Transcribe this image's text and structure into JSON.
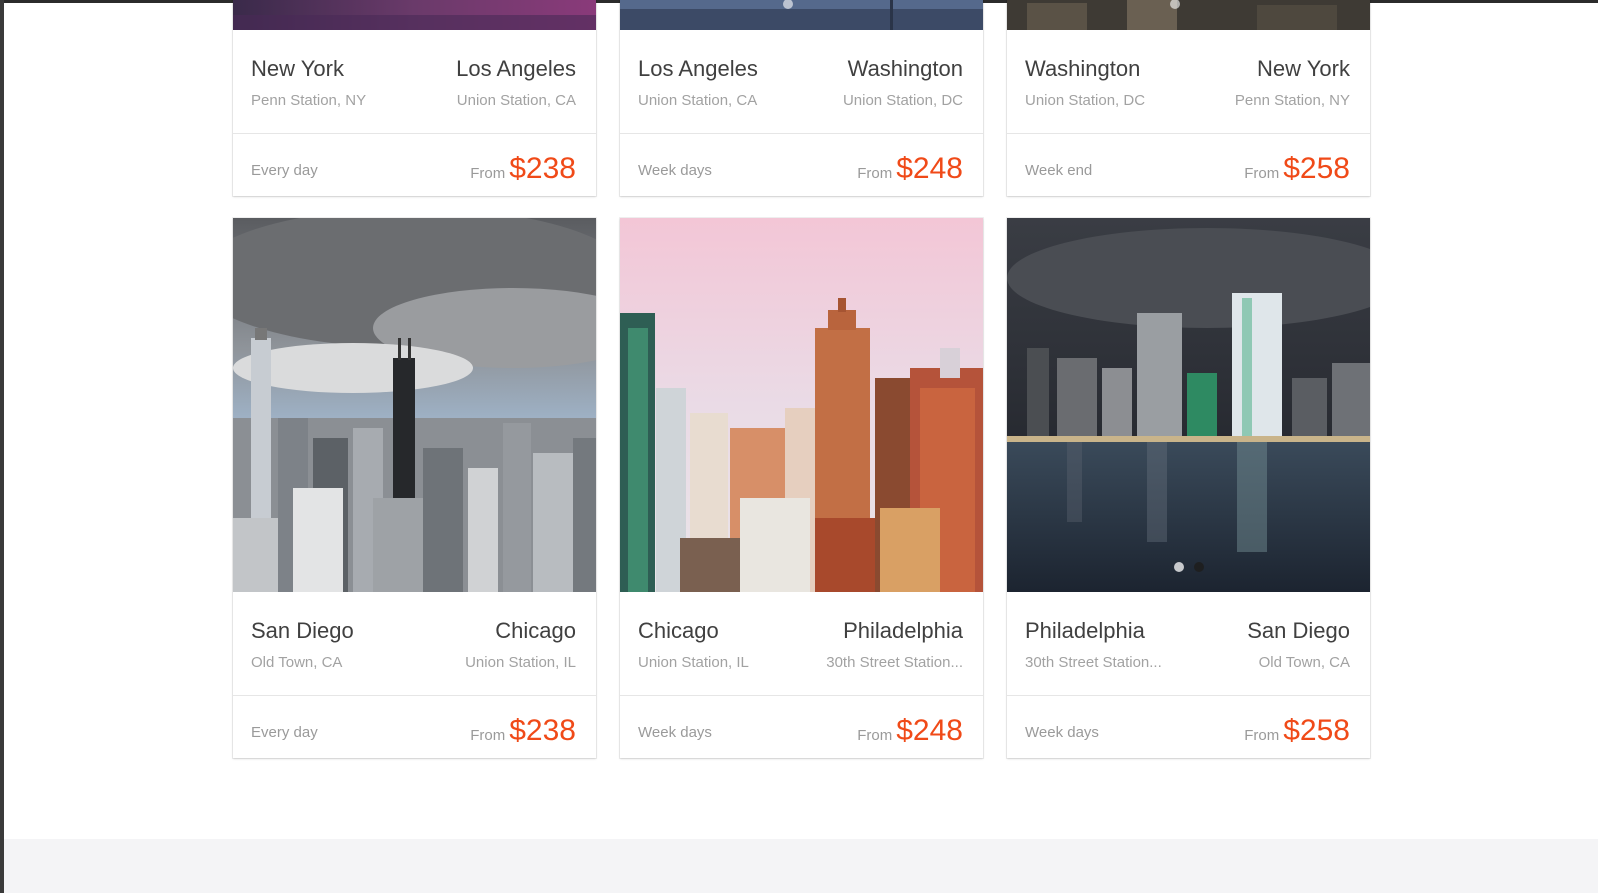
{
  "theme": {
    "accent": "#f04a18",
    "footer_bg": "#f4f4f6"
  },
  "from_label": "From",
  "cards_top": [
    {
      "from_city": "New York",
      "from_station": "Penn Station, NY",
      "to_city": "Los Angeles",
      "to_station": "Union Station, CA",
      "frequency": "Every day",
      "price": "$238"
    },
    {
      "from_city": "Los Angeles",
      "from_station": "Union Station, CA",
      "to_city": "Washington",
      "to_station": "Union Station, DC",
      "frequency": "Week days",
      "price": "$248"
    },
    {
      "from_city": "Washington",
      "from_station": "Union Station, DC",
      "to_city": "New York",
      "to_station": "Penn Station, NY",
      "frequency": "Week end",
      "price": "$258"
    }
  ],
  "cards_bottom": [
    {
      "from_city": "San Diego",
      "from_station": "Old Town, CA",
      "to_city": "Chicago",
      "to_station": "Union Station, IL",
      "frequency": "Every day",
      "price": "$238",
      "image": "chicago-skyline-photo"
    },
    {
      "from_city": "Chicago",
      "from_station": "Union Station, IL",
      "to_city": "Philadelphia",
      "to_station": "30th Street Station...",
      "frequency": "Week days",
      "price": "$248",
      "image": "philadelphia-city-photo"
    },
    {
      "from_city": "Philadelphia",
      "from_station": "30th Street Station...",
      "to_city": "San Diego",
      "to_station": "Old Town, CA",
      "frequency": "Week days",
      "price": "$258",
      "image": "san-diego-night-photo"
    }
  ],
  "carousel": {
    "bottom_right_active_index": 1,
    "dot_count": 2
  }
}
